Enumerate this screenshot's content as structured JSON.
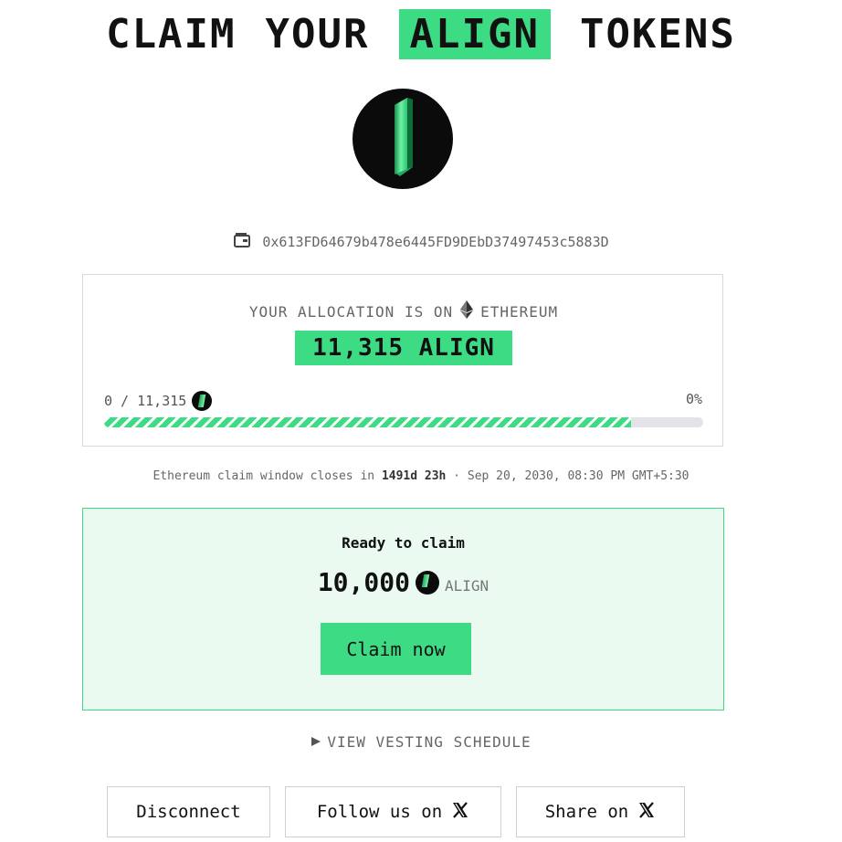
{
  "header": {
    "title_prefix_1": "CLAIM",
    "title_prefix_2": "YOUR",
    "title_highlight": "ALIGN",
    "title_suffix": "TOKENS"
  },
  "logo": {
    "icon": "align-logo-icon"
  },
  "wallet": {
    "icon": "wallet-icon",
    "address": "0x613FD64679b478e6445FD9DEbD37497453c5883D"
  },
  "allocation": {
    "label_prefix": "YOUR ALLOCATION IS ON",
    "network_icon": "ethereum-icon",
    "network": "ETHEREUM",
    "amount": "11,315 ALIGN",
    "progress_text": "0 / 11,315",
    "progress_percent": "0%",
    "progress_fill_fraction": 0.88
  },
  "claim_window": {
    "prefix": "Ethereum claim window closes in",
    "remaining": "1491d 23h",
    "separator": "·",
    "date": "Sep 20, 2030, 08:30 PM GMT+5:30"
  },
  "ready": {
    "label": "Ready to claim",
    "amount": "10,000",
    "unit": "ALIGN",
    "button": "Claim now"
  },
  "vesting": {
    "icon": "triangle-right-icon",
    "label": "VIEW VESTING SCHEDULE"
  },
  "footer": {
    "disconnect": "Disconnect",
    "follow": "Follow us on",
    "share": "Share on",
    "x_icon": "x-logo-icon"
  },
  "colors": {
    "accent": "#3ddc84",
    "ready_bg": "#eafaf0"
  }
}
